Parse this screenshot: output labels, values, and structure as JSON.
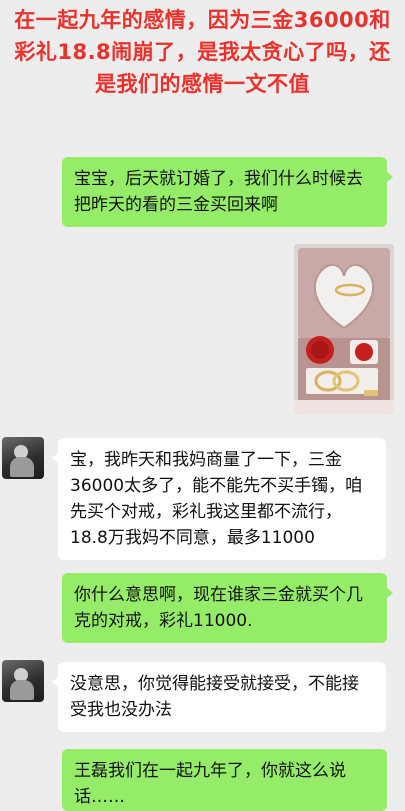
{
  "headline": "在一起九年的感情，因为三金36000和彩礼18.8闹崩了，是我太贪心了吗，还是我们的感情一文不值",
  "messages": [
    {
      "sender": "me",
      "text": "宝宝，后天就订婚了，我们什么时候去把昨天的看的三金买回来啊"
    },
    {
      "sender": "me",
      "type": "image",
      "description": "jewelry-box-photo"
    },
    {
      "sender": "them",
      "text": "宝，我昨天和我妈商量了一下，三金36000太多了，能不能先不买手镯，咱先买个对戒，彩礼我这里都不流行，18.8万我妈不同意，最多11000"
    },
    {
      "sender": "me",
      "text": "你什么意思啊，现在谁家三金就买个几克的对戒，彩礼11000."
    },
    {
      "sender": "them",
      "text": "没意思，你觉得能接受就接受，不能接受我也没办法"
    },
    {
      "sender": "me",
      "text": "王磊我们在一起九年了，你就这么说话……"
    }
  ],
  "colors": {
    "headline": "#e8322b",
    "my_bubble": "#95ec69",
    "their_bubble": "#ffffff",
    "background": "#ededed"
  }
}
